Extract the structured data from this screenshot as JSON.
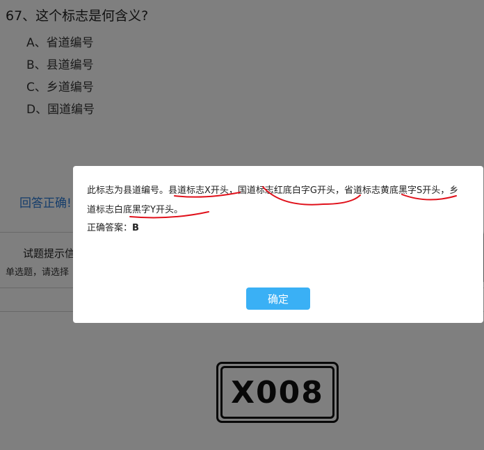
{
  "question": {
    "title": "67、这个标志是何含义?",
    "options": [
      "A、省道编号",
      "B、县道编号",
      "C、乡道编号",
      "D、国道编号"
    ],
    "feedback": "回答正确!",
    "hint_title": "试题提示信",
    "hint_text": "单选题，请选择",
    "sign_text": "X008"
  },
  "dialog": {
    "explanation": "此标志为县道编号。县道标志X开头，国道标志红底白字G开头，省道标志黄底黑字S开头，乡道标志白底黑字Y开头。",
    "answer_label": "正确答案：",
    "answer_value": "B",
    "ok_label": "确定"
  },
  "colors": {
    "overlay": "rgba(0,0,0,0.5)",
    "button": "#3ab0f5",
    "annotation": "#e0101a",
    "feedback": "#2a7ad6"
  }
}
